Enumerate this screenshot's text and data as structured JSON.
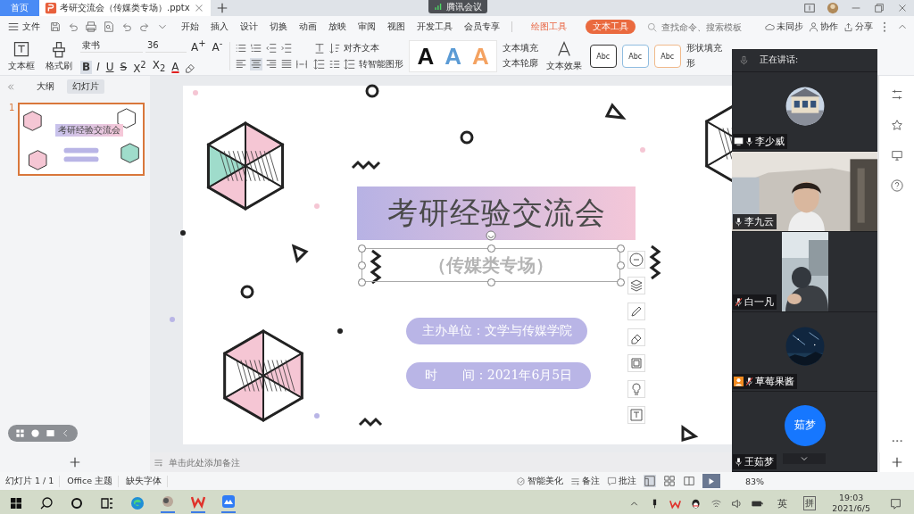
{
  "tabs": [
    {
      "label": "首页",
      "kind": "home",
      "selected": false
    },
    {
      "label": "考研交流会（传媒类专场）.pptx",
      "kind": "doc",
      "selected": true
    }
  ],
  "meeting_pill": "腾讯会议",
  "menu": {
    "file": "文件",
    "items": [
      {
        "label": "开始",
        "selected": false
      },
      {
        "label": "插入",
        "selected": false
      },
      {
        "label": "设计",
        "selected": false
      },
      {
        "label": "切换",
        "selected": false
      },
      {
        "label": "动画",
        "selected": false
      },
      {
        "label": "放映",
        "selected": false
      },
      {
        "label": "审阅",
        "selected": false
      },
      {
        "label": "视图",
        "selected": false
      },
      {
        "label": "开发工具",
        "selected": false
      },
      {
        "label": "会员专享",
        "selected": false
      }
    ],
    "context": [
      {
        "label": "绘图工具",
        "selected": false
      },
      {
        "label": "文本工具",
        "selected": true
      }
    ],
    "search": {
      "placeholder": "查找命令、搜索模板"
    },
    "actions": [
      {
        "label": "未同步",
        "kind": "cloud"
      },
      {
        "label": "协作",
        "kind": "person"
      },
      {
        "label": "分享",
        "kind": "share"
      }
    ]
  },
  "ribbon": {
    "textbox": "文本框",
    "format_painter": "格式刷",
    "font": "隶书",
    "size": "36",
    "grow": "A$^{+}$",
    "shrink": "A$^{-}$",
    "format_buttons": [
      {
        "label": "B",
        "selected": true
      },
      {
        "label": "I",
        "selected": false
      },
      {
        "label": "U",
        "selected": false
      },
      {
        "label": "S",
        "selected": false
      },
      {
        "label": "X$^{2}$",
        "selected": false
      },
      {
        "label": "X$_{2}$",
        "selected": false
      }
    ],
    "font_color": "A",
    "alignments": [
      {
        "kind": "left",
        "selected": false
      },
      {
        "kind": "center",
        "selected": true
      },
      {
        "kind": "right",
        "selected": false
      },
      {
        "kind": "justify",
        "selected": false
      },
      {
        "kind": "distribute",
        "selected": false
      }
    ],
    "align_text": "对齐文本",
    "smart_shape": "转智能图形",
    "text_styles": [
      {
        "label": "A",
        "color": "#111111"
      },
      {
        "label": "A",
        "color": "#5b9bd5"
      },
      {
        "label": "A",
        "color": "#f4a261"
      }
    ],
    "text_fill": "文本填充",
    "text_outline": "文本轮廓",
    "text_effect": "文本效果",
    "shape_styles": [
      {
        "label": "Abc",
        "color": "#333333"
      },
      {
        "label": "Abc",
        "color": "#8fbce0"
      },
      {
        "label": "Abc",
        "color": "#f0b98a"
      }
    ],
    "shape_fill": "形状填充",
    "shape_outline": "形"
  },
  "sidebar": {
    "tabs": [
      {
        "label": "大纲",
        "selected": false
      },
      {
        "label": "幻灯片",
        "selected": true
      }
    ],
    "slides": [
      {
        "number": "1",
        "title": "考研经验交流会",
        "selected": true
      }
    ]
  },
  "slide": {
    "title": "考研经验交流会",
    "subtitle": "（传媒类专场）",
    "pills": [
      "主办单位：文学与传媒学院",
      "时　　间：2021年6月5日"
    ]
  },
  "notes": {
    "placeholder": "单击此处添加备注"
  },
  "status_bar": {
    "items": [
      "幻灯片 1 / 1",
      "Office 主题",
      "缺失字体"
    ],
    "beautify": "智能美化",
    "notes": "备注",
    "comments": "批注",
    "views": [
      {
        "kind": "normal",
        "selected": true
      },
      {
        "kind": "sorter",
        "selected": false
      },
      {
        "kind": "reading",
        "selected": false
      }
    ],
    "zoom": "83%"
  },
  "meeting": {
    "header": "正在讲话:",
    "participants": [
      {
        "name": "李少威",
        "kind": "avatar",
        "muted": false,
        "sharing": true,
        "host": false
      },
      {
        "name": "李九云",
        "kind": "video",
        "muted": false,
        "sharing": false,
        "host": false
      },
      {
        "name": "白一凡",
        "kind": "video2",
        "muted": true,
        "sharing": false,
        "host": false
      },
      {
        "name": "草莓果酱",
        "kind": "avatar2",
        "muted": true,
        "sharing": false,
        "host": true
      },
      {
        "name": "王茹梦",
        "kind": "initials",
        "initials": "茹梦",
        "muted": false,
        "sharing": false,
        "host": false
      }
    ]
  },
  "taskbar": {
    "lang": "英",
    "ime": "拼",
    "time": "19:03",
    "date": "2021/6/5"
  }
}
